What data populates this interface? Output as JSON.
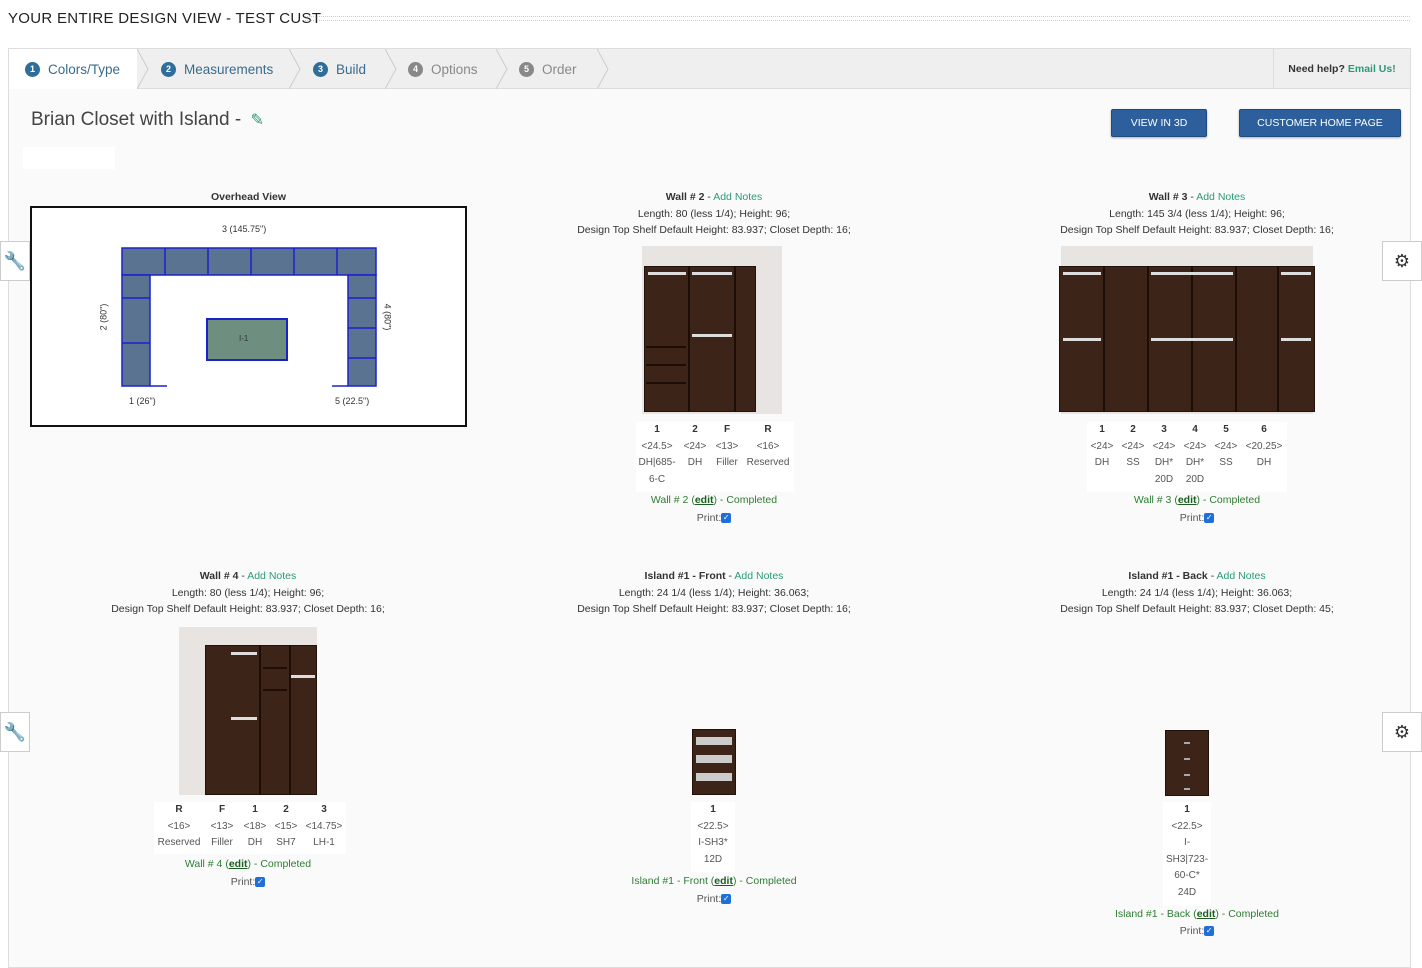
{
  "page": {
    "title": "YOUR ENTIRE DESIGN VIEW - TEST CUST"
  },
  "steps": [
    {
      "num": "1",
      "label": "Colors/Type"
    },
    {
      "num": "2",
      "label": "Measurements"
    },
    {
      "num": "3",
      "label": "Build"
    },
    {
      "num": "4",
      "label": "Options"
    },
    {
      "num": "5",
      "label": "Order"
    }
  ],
  "help": {
    "text": "Need help?",
    "link": "Email Us!"
  },
  "design": {
    "name": "Brian Closet with Island -"
  },
  "buttons": {
    "view3d": "VIEW IN 3D",
    "home": "CUSTOMER HOME PAGE"
  },
  "overhead": {
    "title": "Overhead View",
    "labels": {
      "top": "3 (145.75\")",
      "left": "2 (80\")",
      "right": "4 (80\")",
      "bottomLeft": "1 (26\")",
      "bottomRight": "5 (22.5\")",
      "island": "I-1"
    }
  },
  "walls": [
    {
      "title": "Wall # 2",
      "notes": "Add Notes",
      "line1": "Length: 80 (less 1/4); Height: 96;",
      "line2": "Design Top Shelf Default Height: 83.937; Closet Depth: 16;",
      "cols": [
        [
          "1",
          "<24.5>",
          "DH|685-",
          "6-C"
        ],
        [
          "2",
          "<24>",
          "DH",
          ""
        ],
        [
          "F",
          "<13>",
          "Filler",
          ""
        ],
        [
          "R",
          "<16>",
          "Reserved",
          ""
        ]
      ],
      "status_name": "Wall # 2",
      "edit": "edit",
      "status": "- Completed",
      "print": "Print:"
    },
    {
      "title": "Wall # 3",
      "notes": "Add Notes",
      "line1": "Length: 145 3/4 (less 1/4); Height: 96;",
      "line2": "Design Top Shelf Default Height: 83.937; Closet Depth: 16;",
      "cols": [
        [
          "1",
          "<24>",
          "DH",
          ""
        ],
        [
          "2",
          "<24>",
          "SS",
          ""
        ],
        [
          "3",
          "<24>",
          "DH*",
          "20D"
        ],
        [
          "4",
          "<24>",
          "DH*",
          "20D"
        ],
        [
          "5",
          "<24>",
          "SS",
          ""
        ],
        [
          "6",
          "<20.25>",
          "DH",
          ""
        ]
      ],
      "status_name": "Wall # 3",
      "edit": "edit",
      "status": "- Completed",
      "print": "Print:"
    },
    {
      "title": "Wall # 4",
      "notes": "Add Notes",
      "line1": "Length: 80 (less 1/4); Height: 96;",
      "line2": "Design Top Shelf Default Height: 83.937; Closet Depth: 16;",
      "cols": [
        [
          "R",
          "<16>",
          "Reserved"
        ],
        [
          "F",
          "<13>",
          "Filler"
        ],
        [
          "1",
          "<18>",
          "DH"
        ],
        [
          "2",
          "<15>",
          "SH7"
        ],
        [
          "3",
          "<14.75>",
          "LH-1"
        ]
      ],
      "status_name": "Wall # 4",
      "edit": "edit",
      "status": "- Completed",
      "print": "Print:"
    },
    {
      "title": "Island #1 - Front",
      "notes": "Add Notes",
      "line1": "Length: 24 1/4 (less 1/4); Height: 36.063;",
      "line2": "Design Top Shelf Default Height: 83.937; Closet Depth: 16;",
      "cols": [
        [
          "1",
          "<22.5>",
          "I-SH3*",
          "12D"
        ]
      ],
      "status_name": "Island #1 - Front",
      "edit": "edit",
      "status": "- Completed",
      "print": "Print:"
    },
    {
      "title": "Island #1 - Back",
      "notes": "Add Notes",
      "line1": "Length: 24 1/4 (less 1/4); Height: 36.063;",
      "line2": "Design Top Shelf Default Height: 83.937; Closet Depth: 45;",
      "cols": [
        [
          "1",
          "<22.5>",
          "I-",
          "SH3|723-",
          "60-C*",
          "24D"
        ]
      ],
      "status_name": "Island #1 - Back",
      "edit": "edit",
      "status": "- Completed",
      "print": "Print:"
    }
  ]
}
